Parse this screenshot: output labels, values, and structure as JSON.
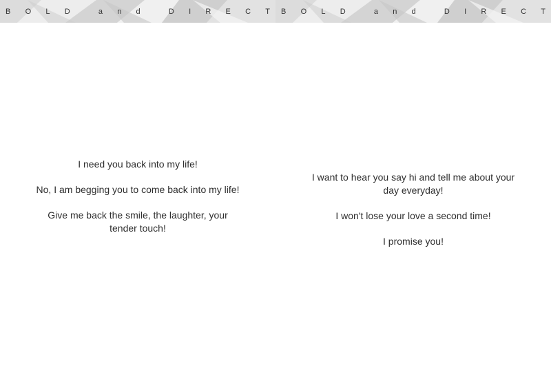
{
  "header": {
    "left_chars": [
      "B",
      "O",
      "L",
      "D",
      "a",
      "n",
      "d",
      "D",
      "I",
      "R",
      "E",
      "C",
      "T"
    ],
    "right_chars": [
      "B",
      "O",
      "L",
      "D",
      "a",
      "n",
      "d",
      "D",
      "I",
      "R",
      "E",
      "C",
      "T"
    ]
  },
  "left_page": {
    "paragraphs": [
      "I need you back into my life!",
      "No, I am begging you to come back into my life!",
      "Give me back the smile, the laughter, your tender touch!"
    ]
  },
  "right_page": {
    "paragraphs": [
      "I want to hear you say hi and tell me about your day everyday!",
      "I won't lose your love a second time!",
      "I promise you!"
    ]
  },
  "colors": {
    "band_base": "#e6e6e6",
    "band_dark": "#c9c9c9",
    "band_light": "#f2f2f2",
    "text": "#2e2e2e"
  }
}
